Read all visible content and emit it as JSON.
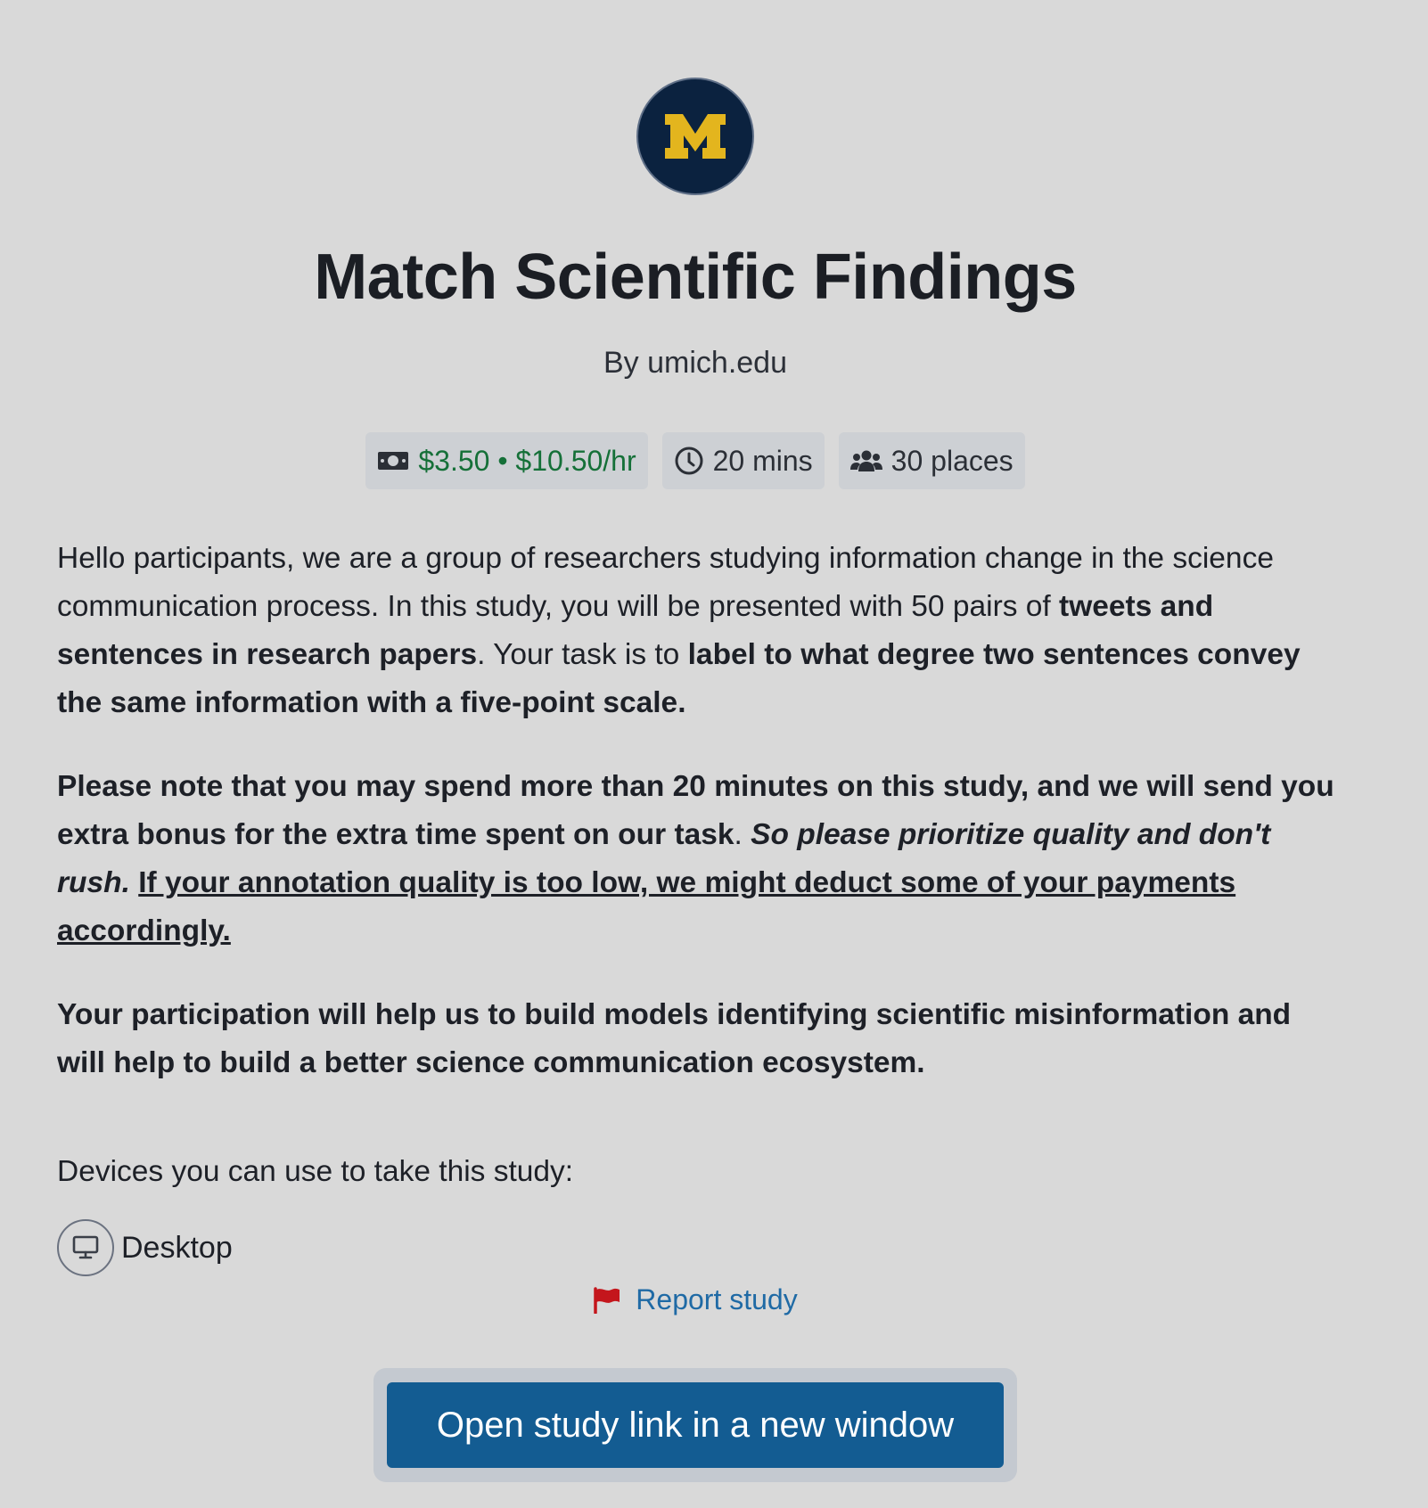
{
  "study": {
    "logo_letter": "M",
    "title": "Match Scientific Findings",
    "byline": "By umich.edu"
  },
  "chips": {
    "reward": "$3.50 • $10.50/hr",
    "duration": "20 mins",
    "places": "30 places"
  },
  "description": {
    "p1_a": "Hello participants, we are a group of researchers studying information change in the science communication process. In this study, you will be presented with 50 pairs of ",
    "p1_b": "tweets and sentences in research papers",
    "p1_c": ". Your task is to ",
    "p1_d": "label to what degree two sentences convey the same information with a five-point scale.",
    "p2_a": "Please note that you may spend more than 20 minutes on this study, and we will send you extra bonus for the extra time spent on our task",
    "p2_b": ". ",
    "p2_c": "So please prioritize quality and don't rush.",
    "p2_d": " ",
    "p2_e": "If your annotation quality is too low, we might deduct some of your payments accordingly. ",
    "p3": "Your participation will help us to build models identifying scientific misinformation and will help to build a better science communication ecosystem."
  },
  "devices": {
    "label": "Devices you can use to take this study:",
    "items": [
      "Desktop"
    ]
  },
  "report_label": "Report study",
  "open_button_label": "Open study link in a new window",
  "colors": {
    "background": "#d9d9d9",
    "logo_bg": "#0b223f",
    "logo_maize": "#e3b51e",
    "reward_green": "#157038",
    "link_blue": "#1f6aa5",
    "flag_red": "#c4161c",
    "button_blue": "#135c92"
  },
  "icons": {
    "reward": "money-icon",
    "duration": "clock-icon",
    "places": "users-icon",
    "device": "desktop-icon",
    "report": "flag-icon"
  }
}
